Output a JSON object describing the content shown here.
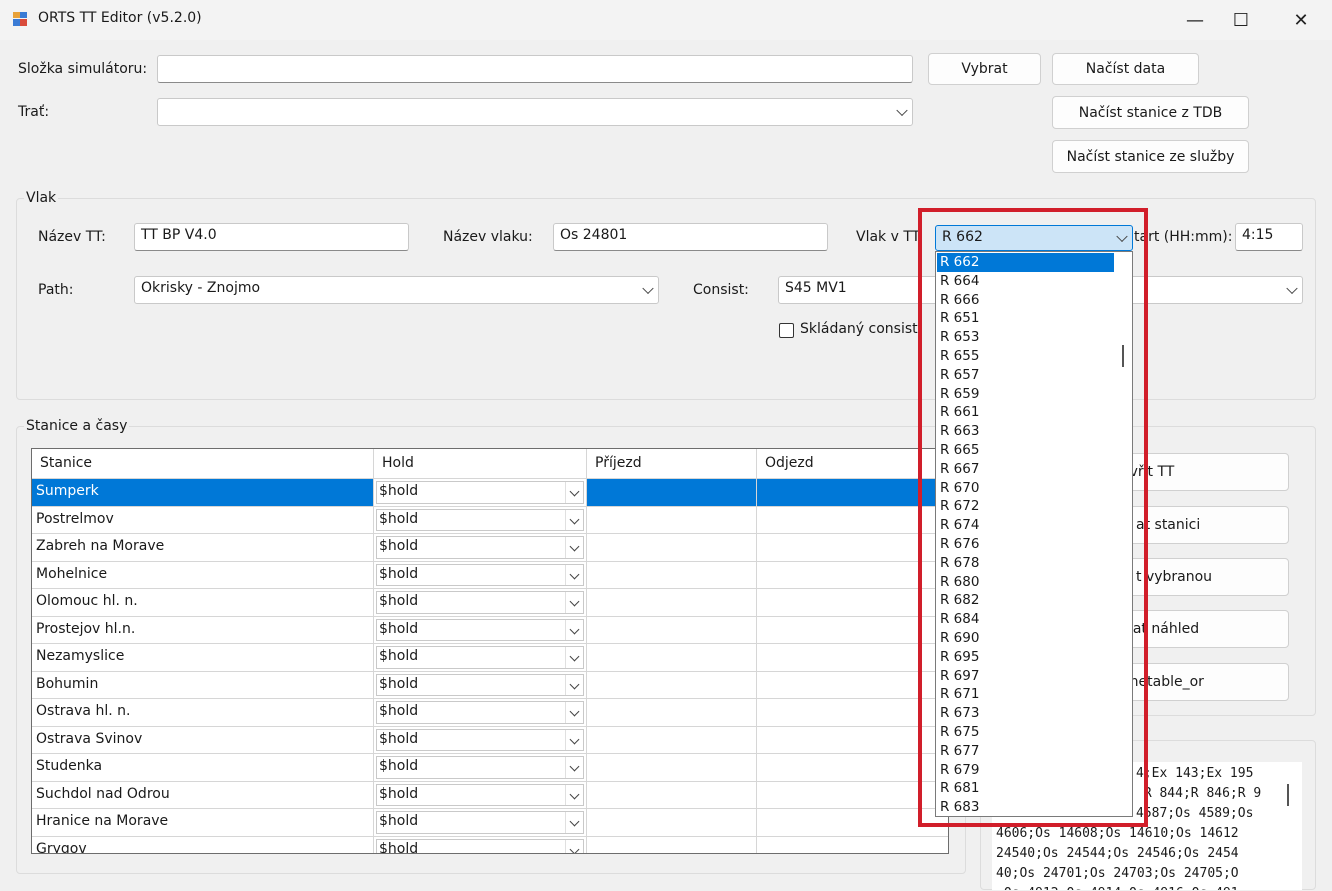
{
  "window": {
    "title": "ORTS TT Editor (v5.2.0)",
    "minimize": "—",
    "maximize": "☐",
    "close": "✕"
  },
  "top": {
    "folder_label": "Složka simulátoru:",
    "folder_value": "",
    "route_label": "Trať:",
    "route_value": "",
    "btn_select": "Vybrat",
    "btn_load_data": "Načíst data",
    "btn_load_stations_tdb": "Načíst stanice z TDB",
    "btn_load_stations_service": "Načíst stanice ze služby"
  },
  "train_group": {
    "title": "Vlak",
    "tt_name_label": "Název TT:",
    "tt_name_value": "TT BP V4.0",
    "train_name_label": "Název vlaku:",
    "train_name_value": "Os 24801",
    "train_in_tt_label": "Vlak v TT:",
    "train_in_tt_value": "R 662",
    "start_label": "tart (HH:mm):",
    "start_value": "4:15",
    "path_label": "Path:",
    "path_value": "Okrisky - Znojmo",
    "consist_label": "Consist:",
    "consist_value": "S45 MV1",
    "stacked_consist_label": "Skládaný consist"
  },
  "stations_group": {
    "title": "Stanice a časy",
    "columns": [
      "Stanice",
      "Hold",
      "Příjezd",
      "Odjezd"
    ],
    "rows": [
      {
        "station": "Sumperk",
        "hold": "$hold",
        "arr": "",
        "dep": ""
      },
      {
        "station": "Postrelmov",
        "hold": "$hold",
        "arr": "",
        "dep": ""
      },
      {
        "station": "Zabreh na Morave",
        "hold": "$hold",
        "arr": "",
        "dep": ""
      },
      {
        "station": "Mohelnice",
        "hold": "$hold",
        "arr": "",
        "dep": ""
      },
      {
        "station": "Olomouc hl. n.",
        "hold": "$hold",
        "arr": "",
        "dep": ""
      },
      {
        "station": "Prostejov hl.n.",
        "hold": "$hold",
        "arr": "",
        "dep": ""
      },
      {
        "station": "Nezamyslice",
        "hold": "$hold",
        "arr": "",
        "dep": ""
      },
      {
        "station": "Bohumin",
        "hold": "$hold",
        "arr": "",
        "dep": ""
      },
      {
        "station": "Ostrava hl. n.",
        "hold": "$hold",
        "arr": "",
        "dep": ""
      },
      {
        "station": "Ostrava Svinov",
        "hold": "$hold",
        "arr": "",
        "dep": ""
      },
      {
        "station": "Studenka",
        "hold": "$hold",
        "arr": "",
        "dep": ""
      },
      {
        "station": "Suchdol nad Odrou",
        "hold": "$hold",
        "arr": "",
        "dep": ""
      },
      {
        "station": "Hranice na Morave",
        "hold": "$hold",
        "arr": "",
        "dep": ""
      },
      {
        "station": "Grygov",
        "hold": "$hold",
        "arr": "",
        "dep": ""
      }
    ]
  },
  "right_buttons": [
    "evřít TT",
    "at stanici",
    "t vybranou",
    "ovat náhled",
    "imetable_or"
  ],
  "log_lines": [
    "4;Ex 143;Ex 195",
    " R 844;R 846;R 9",
    "4587;Os 4589;Os ",
    "4606;Os 14608;Os 14610;Os 14612",
    "24540;Os 24544;Os 24546;Os 2454",
    "40;Os 24701;Os 24703;Os 24705;O",
    ";Os 4912;Os 4914;Os 4916;Os 491"
  ],
  "dropdown_items": [
    "R 662",
    "R 664",
    "R 666",
    "R 651",
    "R 653",
    "R 655",
    "R 657",
    "R 659",
    "R 661",
    "R 663",
    "R 665",
    "R 667",
    "R 670",
    "R 672",
    "R 674",
    "R 676",
    "R 678",
    "R 680",
    "R 682",
    "R 684",
    "R 690",
    "R 695",
    "R 697",
    "R 671",
    "R 673",
    "R 675",
    "R 677",
    "R 679",
    "R 681",
    "R 683"
  ],
  "dropdown_selected": "R 662",
  "colors": {
    "highlight": "#d11e2a",
    "selection": "#0078d7"
  }
}
